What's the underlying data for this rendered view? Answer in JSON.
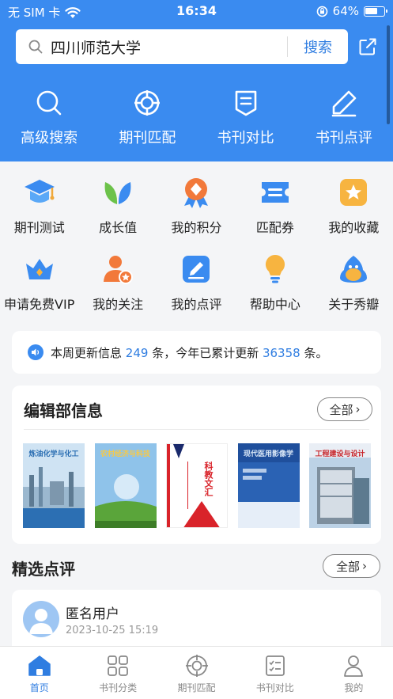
{
  "status_bar": {
    "carrier": "无 SIM 卡",
    "time": "16:34",
    "battery": "64%"
  },
  "search": {
    "value": "四川师范大学",
    "button": "搜索"
  },
  "top_menu": [
    {
      "label": "高级搜索",
      "icon": "search-icon"
    },
    {
      "label": "期刊匹配",
      "icon": "target-icon"
    },
    {
      "label": "书刊对比",
      "icon": "document-compare-icon"
    },
    {
      "label": "书刊点评",
      "icon": "pen-icon"
    }
  ],
  "grid": [
    {
      "label": "期刊测试",
      "icon": "graduation-cap-icon"
    },
    {
      "label": "成长值",
      "icon": "leaf-icon"
    },
    {
      "label": "我的积分",
      "icon": "medal-icon"
    },
    {
      "label": "匹配券",
      "icon": "ticket-icon"
    },
    {
      "label": "我的收藏",
      "icon": "star-box-icon"
    },
    {
      "label": "申请免费VIP",
      "icon": "crown-icon"
    },
    {
      "label": "我的关注",
      "icon": "user-star-icon"
    },
    {
      "label": "我的点评",
      "icon": "edit-icon"
    },
    {
      "label": "帮助中心",
      "icon": "lightbulb-icon"
    },
    {
      "label": "关于秀瓣",
      "icon": "mascot-icon"
    }
  ],
  "notice": {
    "p1": "本周更新信息 ",
    "weekly_count": "249",
    "p2": " 条，今年已累计更新 ",
    "yearly_count": "36358",
    "p3": " 条。"
  },
  "editorial": {
    "title": "编辑部信息",
    "all_button": "全部",
    "covers": [
      {
        "title": "炼油化学与化工",
        "bg": "#cfe3f3",
        "accent": "#2c6fb3"
      },
      {
        "title": "农村经济与科技",
        "bg": "#8fc3ea",
        "accent": "#5aa53a"
      },
      {
        "title": "科教文汇",
        "bg": "#ffffff",
        "accent": "#d9232a"
      },
      {
        "title": "现代医用影像学",
        "bg": "#1f4f9c",
        "accent": "#d8e6f6"
      },
      {
        "title": "工程建设与设计",
        "bg": "#e9eef5",
        "accent": "#c8262b"
      }
    ]
  },
  "reviews": {
    "title": "精选点评",
    "all_button": "全部",
    "items": [
      {
        "user": "匿名用户",
        "time": "2023-10-25 15:19"
      }
    ]
  },
  "tabbar": [
    {
      "label": "首页",
      "icon": "home-icon",
      "active": true
    },
    {
      "label": "书刊分类",
      "icon": "grid-icon",
      "active": false
    },
    {
      "label": "期刊匹配",
      "icon": "target-icon",
      "active": false
    },
    {
      "label": "书刊对比",
      "icon": "checklist-icon",
      "active": false
    },
    {
      "label": "我的",
      "icon": "user-icon",
      "active": false
    }
  ],
  "colors": {
    "primary": "#3a8bf0",
    "link": "#2f7de1"
  }
}
